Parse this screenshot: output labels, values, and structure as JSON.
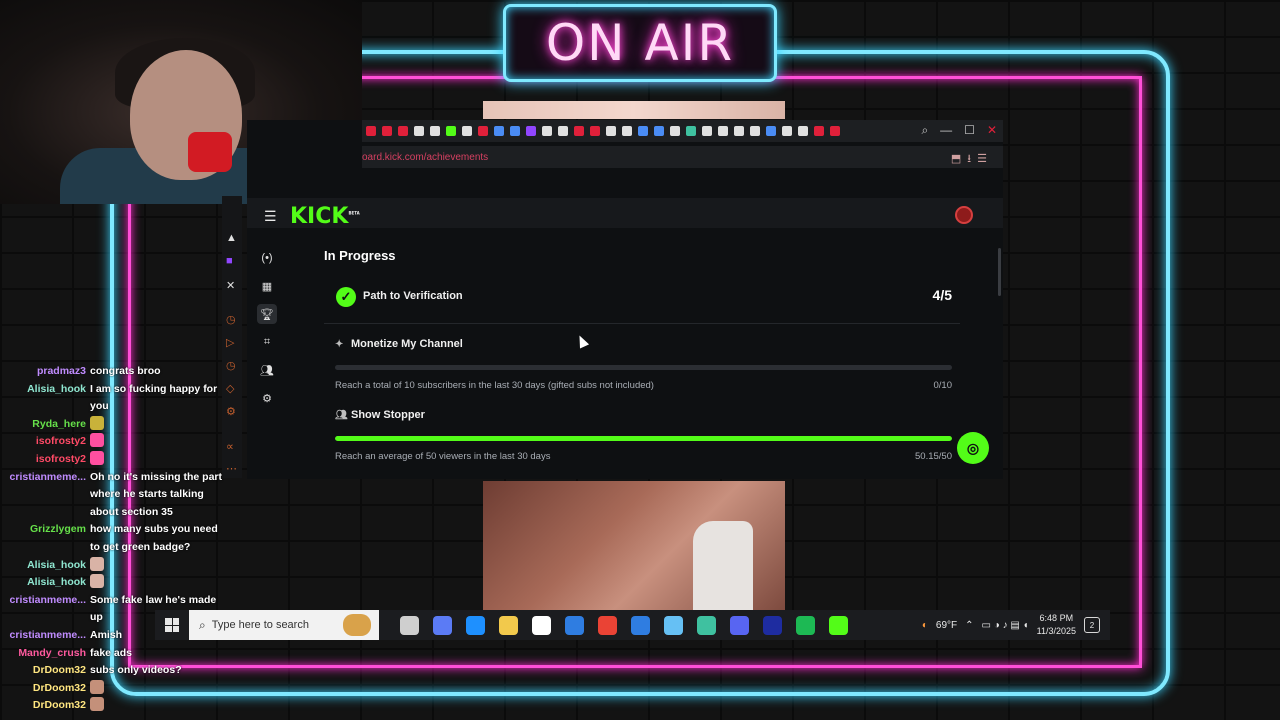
{
  "overlay": {
    "on_air_text": "ON AIR",
    "colors": {
      "neon_cyan": "#7fe9ff",
      "neon_pink": "#ff4fd8",
      "kick_green": "#53fc18"
    }
  },
  "browser": {
    "url": "oard.kick.com/achievements",
    "tab_colors": [
      "#e0203a",
      "#e0203a",
      "#e0203a",
      "#e0e0e0",
      "#e0e0e0",
      "#53fc18",
      "#e0e0e0",
      "#e0203a",
      "#4a8cf5",
      "#4a8cf5",
      "#9146ff",
      "#e0e0e0",
      "#e0e0e0",
      "#e0203a",
      "#e0203a",
      "#e0e0e0",
      "#e0e0e0",
      "#4a8cf5",
      "#4a8cf5",
      "#e0e0e0",
      "#3fc1a0",
      "#e0e0e0",
      "#e0e0e0",
      "#e0e0e0",
      "#e0e0e0",
      "#4a8cf5",
      "#e0e0e0",
      "#e0e0e0",
      "#e0203a",
      "#e0203a"
    ],
    "window_controls": [
      "search-icon",
      "minimize-icon",
      "maximize-icon",
      "close-icon"
    ]
  },
  "kick": {
    "logo": "KICK",
    "logo_badge": "BETA",
    "nav_icons": [
      "live-icon",
      "dashboard-icon",
      "trophy-icon",
      "scan-icon",
      "users-icon",
      "settings-icon"
    ],
    "section_title": "In Progress",
    "path": {
      "label": "Path to Verification",
      "count": "4/5"
    },
    "achievements": [
      {
        "title": "Monetize My Channel",
        "icon": "sparkle-icon",
        "description": "Reach a total of 10 subscribers in the last 30 days (gifted subs not included)",
        "progress_text": "0/10",
        "progress": 0.0
      },
      {
        "title": "Show Stopper",
        "icon": "users-icon",
        "description": "Reach an average of 50 viewers in the last 30 days",
        "progress_text": "50.15/50",
        "progress": 1.0
      }
    ]
  },
  "taskbar": {
    "search_placeholder": "Type here to search",
    "weather": "69°F",
    "time": "6:48 PM",
    "date": "11/3/2025",
    "notifications": "2",
    "app_icon_colors": [
      "#cfcfcf",
      "#5b7bf5",
      "#1e90ff",
      "#f2c94c",
      "#ffffff",
      "#2f7de1",
      "#ea4335",
      "#2f7de1",
      "#66c0f4",
      "#3fc1a0",
      "#5865f2",
      "#1e2ca0",
      "#1db954",
      "#53fc18"
    ]
  },
  "chat": [
    {
      "user": "pradmaz3",
      "color": "#c08cff",
      "text": "congrats broo"
    },
    {
      "user": "Alisia_hook",
      "color": "#8fe6d0",
      "text": "I am so fucking happy for you"
    },
    {
      "user": "Ryda_here",
      "color": "#66e04a",
      "text": "",
      "emote": "#c9b23a"
    },
    {
      "user": "isofrosty2",
      "color": "#ff4a66",
      "text": "",
      "emote": "#ff4fa0"
    },
    {
      "user": "isofrosty2",
      "color": "#ff4a66",
      "text": "",
      "emote": "#ff4fa0"
    },
    {
      "user": "cristianmeme...",
      "color": "#c08cff",
      "text": "Oh no it's missing the part where he starts talking about section 35"
    },
    {
      "user": "Grizzlygem",
      "color": "#66e04a",
      "text": "how many subs you need to get green badge?"
    },
    {
      "user": "Alisia_hook",
      "color": "#8fe6d0",
      "text": "",
      "emote": "#d9b3a6"
    },
    {
      "user": "Alisia_hook",
      "color": "#8fe6d0",
      "text": "",
      "emote": "#d9b3a6"
    },
    {
      "user": "cristianmeme...",
      "color": "#c08cff",
      "text": "Some fake law he's made up"
    },
    {
      "user": "cristianmeme...",
      "color": "#c08cff",
      "text": "Amish"
    },
    {
      "user": "Mandy_crush",
      "color": "#ff5a9e",
      "text": "fake ads"
    },
    {
      "user": "DrDoom32",
      "color": "#ffe680",
      "text": "subs only videos?"
    },
    {
      "user": "DrDoom32",
      "color": "#ffe680",
      "text": "",
      "emote": "#c4907a"
    },
    {
      "user": "DrDoom32",
      "color": "#ffe680",
      "text": "",
      "emote": "#c4907a"
    }
  ]
}
